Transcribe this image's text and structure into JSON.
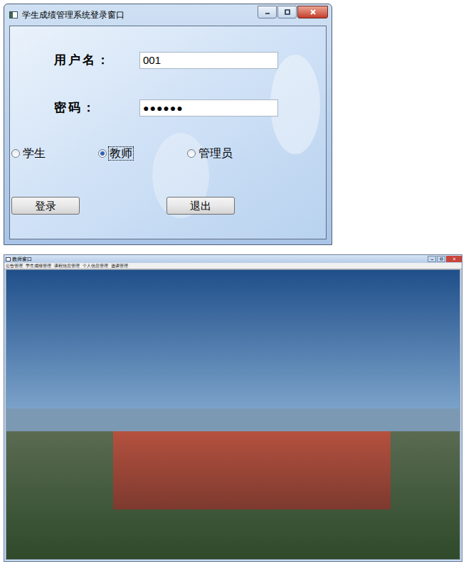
{
  "login_window": {
    "title": "学生成绩管理系统登录窗口",
    "fields": [
      {
        "label": "用户名：",
        "value": "001"
      },
      {
        "label": "密码：",
        "value": "●●●●●●"
      }
    ],
    "roles": [
      {
        "label": "学生",
        "selected": false
      },
      {
        "label": "教师",
        "selected": true
      },
      {
        "label": "管理员",
        "selected": false
      }
    ],
    "buttons": [
      "登录",
      "退出"
    ]
  },
  "main_window": {
    "title": "教师窗口",
    "menu": [
      "公告管理",
      "学生成绩管理",
      "课程信息管理",
      "个人信息管理",
      "选课管理"
    ]
  }
}
